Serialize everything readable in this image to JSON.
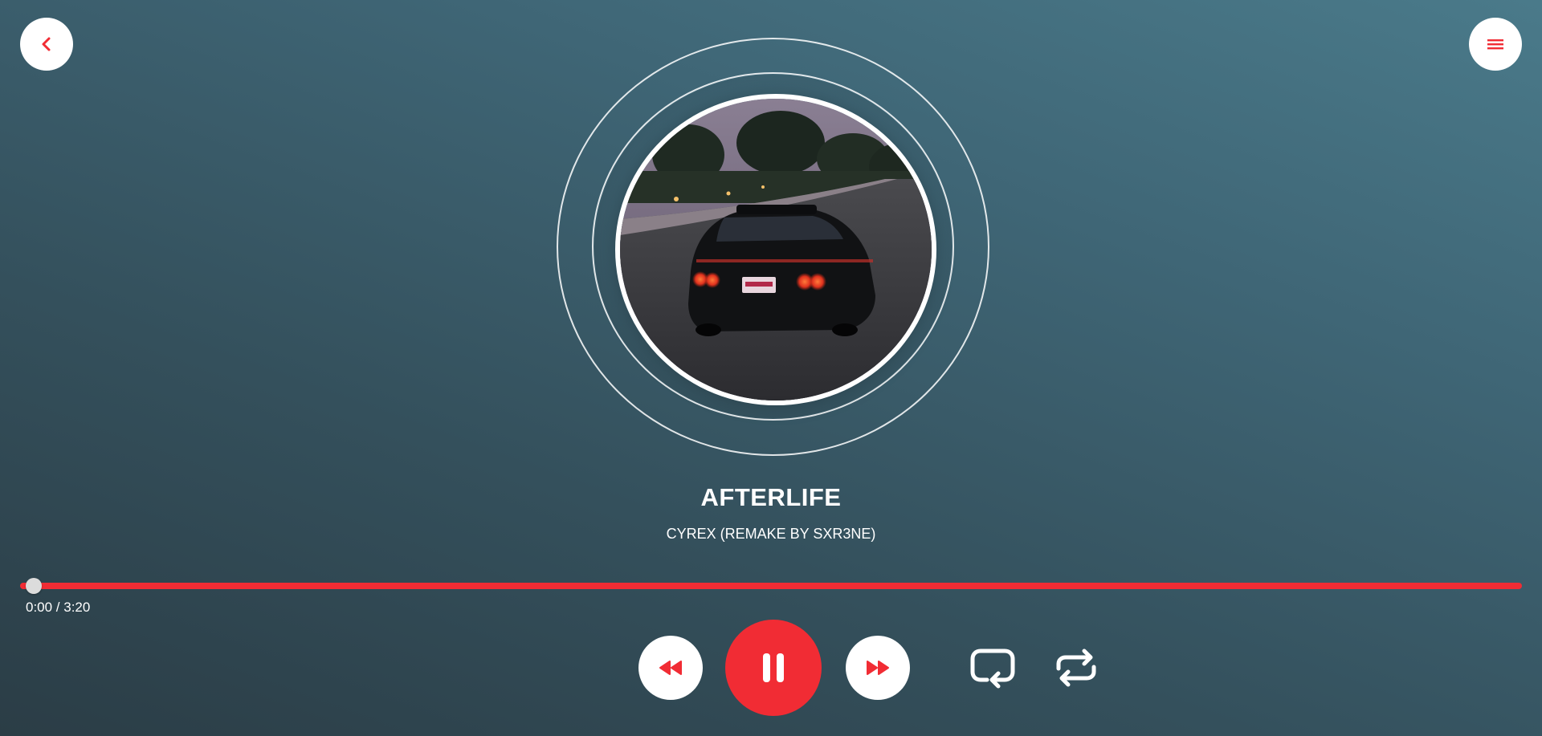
{
  "header": {
    "back_icon": "chevron-left-icon",
    "menu_icon": "menu-icon"
  },
  "track": {
    "title": "AFTERLIFE",
    "artist": "CYREX (REMAKE BY SXR3NE)",
    "album_art": "album-art-image"
  },
  "progress": {
    "time_text": "0:00 / 3:20",
    "position_fraction": 0.0
  },
  "controls": {
    "previous_icon": "rewind-icon",
    "play_pause_icon": "pause-icon",
    "next_icon": "fast-forward-icon",
    "repeat_one_icon": "repeat-one-icon",
    "repeat_icon": "repeat-icon"
  },
  "colors": {
    "accent": "#f12c34",
    "button_bg": "#ffffff",
    "text": "#ffffff"
  }
}
